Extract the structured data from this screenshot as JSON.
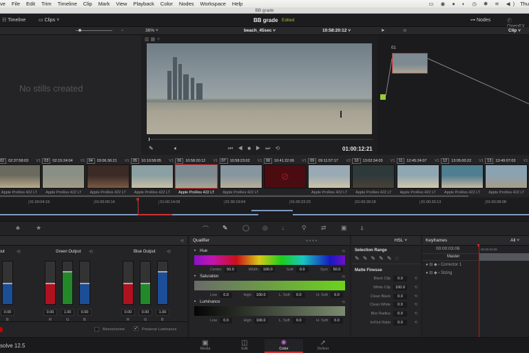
{
  "menubar": {
    "items": [
      "ve",
      "File",
      "Edit",
      "Trim",
      "Timeline",
      "Clip",
      "Mark",
      "View",
      "Playback",
      "Color",
      "Nodes",
      "Workspace",
      "Help"
    ],
    "clock": "Thu"
  },
  "window_title": "BB grade",
  "header": {
    "timeline": "Timeline",
    "clips": "Clips",
    "project": "BB grade",
    "status": "Edited",
    "nodes": "Nodes",
    "openfx": "OpenFX"
  },
  "toolbar": {
    "zoom": "36%",
    "clip_name": "beach_45sec",
    "timecode": "10:58:20:12",
    "mode": "Clip"
  },
  "gallery": {
    "empty": "No stills created"
  },
  "viewer": {
    "timecode": "01:00:12:21"
  },
  "node": {
    "label": "01"
  },
  "clips": [
    {
      "num": "02",
      "tc": "02:37:58:03",
      "trk": "V1",
      "codec": "Apple ProRes 422 LT",
      "c": [
        "#6b6a5e",
        "#b9aa8a"
      ]
    },
    {
      "num": "03",
      "tc": "02:15:24:04",
      "trk": "V1",
      "codec": "Apple ProRes 422 LT",
      "c": [
        "#8a8f86",
        "#a39b86"
      ]
    },
    {
      "num": "04",
      "tc": "03:06:36:21",
      "trk": "V1",
      "codec": "Apple ProRes 422 LT",
      "c": [
        "#3b2a25",
        "#7a5a44"
      ]
    },
    {
      "num": "05",
      "tc": "10:10:58:05",
      "trk": "V1",
      "codec": "Apple ProRes 422 LT",
      "c": [
        "#8aa0a2",
        "#c8bfa4"
      ]
    },
    {
      "num": "06",
      "tc": "10:58:20:12",
      "trk": "V1",
      "codec": "Apple ProRes 422 LT",
      "c": [
        "#7d8a92",
        "#aaa594"
      ],
      "selected": true
    },
    {
      "num": "07",
      "tc": "10:58:23:02",
      "trk": "V1",
      "codec": "Apple ProRes 422 LT",
      "c": [
        "#8795a0",
        "#b8ae98"
      ]
    },
    {
      "num": "08",
      "tc": "10:41:22:00",
      "trk": "V1",
      "codec": "",
      "c": [
        "#4a0c10",
        "#4a0c10"
      ],
      "offline": true
    },
    {
      "num": "09",
      "tc": "09:11:57:17",
      "trk": "V2",
      "codec": "Apple ProRes 422 LT",
      "c": [
        "#9aaab4",
        "#cdc3a8"
      ]
    },
    {
      "num": "10",
      "tc": "13:02:34:03",
      "trk": "V1",
      "codec": "Apple ProRes 422 LT",
      "c": [
        "#2e3a3a",
        "#4a4036"
      ]
    },
    {
      "num": "11",
      "tc": "12:45:24:07",
      "trk": "V1",
      "codec": "Apple ProRes 422 LT",
      "c": [
        "#8fa7b2",
        "#d2c7ab"
      ]
    },
    {
      "num": "12",
      "tc": "13:05:00:22",
      "trk": "V1",
      "codec": "Apple ProRes 422 LT",
      "c": [
        "#4e7e90",
        "#c9b8a0"
      ]
    },
    {
      "num": "13",
      "tc": "13:49:07:03",
      "trk": "V1",
      "codec": "Apple ProRes 422 LT",
      "c": [
        "#8aa2b2",
        "#a99c86"
      ]
    }
  ],
  "ruler": [
    "01:00:04:19",
    "01:00:09:14",
    "01:00:14:09",
    "01:00:19:04",
    "01:00:23:23",
    "01:00:28:18",
    "01:00:33:13",
    "01:00:38:08"
  ],
  "rgb_mixer": {
    "groups": [
      {
        "title": "Red Output",
        "values": [
          "0.00"
        ],
        "labels": [
          "B"
        ]
      },
      {
        "title": "Green Output",
        "values": [
          "0.00",
          "1.00",
          "0.00"
        ],
        "labels": [
          "R",
          "G",
          "B"
        ]
      },
      {
        "title": "Blue Output",
        "values": [
          "0.00",
          "0.00",
          "1.00"
        ],
        "labels": [
          "R",
          "G",
          "B"
        ]
      }
    ],
    "monochrome": "Monochrome",
    "preserve": "Preserve Luminance"
  },
  "qualifier": {
    "title": "Qualifier",
    "mode": "HSL",
    "hue": {
      "label": "Hue",
      "fields": [
        [
          "Center",
          "50.0"
        ],
        [
          "Width",
          "100.0"
        ],
        [
          "Soft",
          "0.0"
        ],
        [
          "Sym",
          "50.0"
        ]
      ]
    },
    "saturation": {
      "label": "Saturation",
      "fields": [
        [
          "Low",
          "0.0"
        ],
        [
          "High",
          "100.0"
        ],
        [
          "L. Soft",
          "0.0"
        ],
        [
          "H. Soft",
          "0.0"
        ]
      ]
    },
    "luminance": {
      "label": "Luminance",
      "fields": [
        [
          "Low",
          "0.0"
        ],
        [
          "High",
          "100.0"
        ],
        [
          "L. Soft",
          "0.0"
        ],
        [
          "H. Soft",
          "0.0"
        ]
      ]
    }
  },
  "selection": {
    "title": "Selection Range",
    "finesse": "Matte Finesse",
    "fields": [
      [
        "Black Clip",
        "0.0"
      ],
      [
        "White Clip",
        "100.0"
      ],
      [
        "Clean Black",
        "0.0"
      ],
      [
        "Clean White",
        "0.0"
      ],
      [
        "Blur Radius",
        "0.0"
      ],
      [
        "In/Out Ratio",
        "0.0"
      ]
    ]
  },
  "keyframes": {
    "title": "Keyframes",
    "filter": "All",
    "timecode": "00:00:03:06",
    "playhead": "00:00:03:06",
    "master": "Master",
    "tracks": [
      "Corrector 1",
      "Sizing"
    ]
  },
  "app": {
    "version": "solve 12.5"
  },
  "pages": [
    {
      "label": "Media",
      "icon": "▣"
    },
    {
      "label": "Edit",
      "icon": "◫"
    },
    {
      "label": "Color",
      "icon": "✺",
      "active": true
    },
    {
      "label": "Deliver",
      "icon": "➚"
    }
  ]
}
